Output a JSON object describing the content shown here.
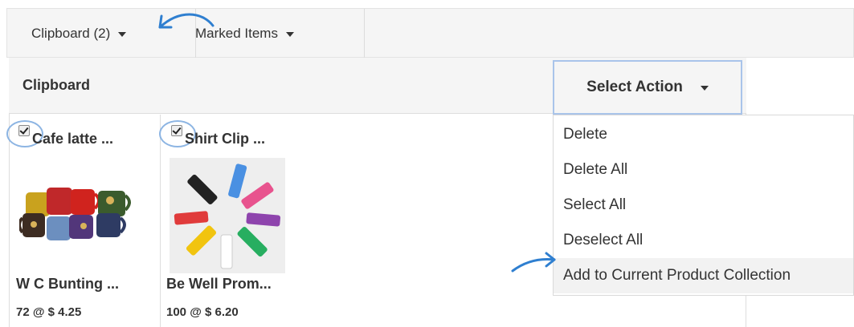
{
  "tabs": {
    "clipboard": "Clipboard (2)",
    "marked": "Marked Items"
  },
  "panel": {
    "title": "Clipboard",
    "action_button": "Select Action"
  },
  "menu": {
    "items": [
      "Delete",
      "Delete All",
      "Select All",
      "Deselect All",
      "Add to Current Product Collection"
    ],
    "highlighted": "Add to Current Product Collection"
  },
  "products": [
    {
      "name": "Cafe latte ...",
      "supplier": "W C Bunting ...",
      "price": "72 @ $ 4.25",
      "checked": true
    },
    {
      "name": "Shirt Clip ...",
      "supplier": "Be Well Prom...",
      "price": "100 @ $ 6.20",
      "checked": true
    }
  ],
  "colors": {
    "annotation": "#2f7fd0",
    "focus_border": "#a9c4ea",
    "header_bg": "#f5f5f5"
  }
}
